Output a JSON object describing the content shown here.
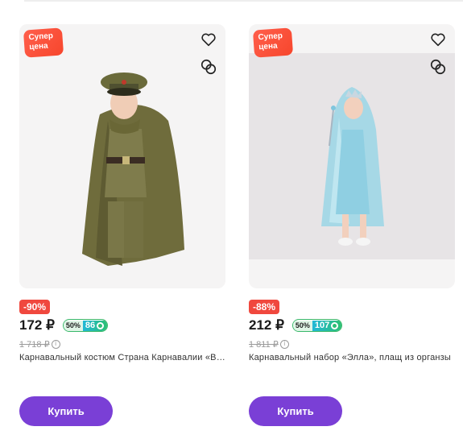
{
  "products": [
    {
      "badge": "Супер цена",
      "discount": "-90%",
      "price": "172 ₽",
      "cashback_pct": "50%",
      "cashback_bonus": "86",
      "old_price": "1 718 ₽",
      "title": "Карнавальный костюм Страна Карнавалии «Военный»",
      "buy_label": "Купить",
      "icons": {
        "favorite": "heart-icon",
        "compare": "compare-icon",
        "info": "info-icon"
      }
    },
    {
      "badge": "Супер цена",
      "discount": "-88%",
      "price": "212 ₽",
      "cashback_pct": "50%",
      "cashback_bonus": "107",
      "old_price": "1 811 ₽",
      "title": "Карнавальный набор «Элла», плащ из органзы",
      "buy_label": "Купить",
      "icons": {
        "favorite": "heart-icon",
        "compare": "compare-icon",
        "info": "info-icon"
      }
    }
  ],
  "colors": {
    "accent": "#7a3fd6",
    "discount": "#f0483e",
    "badge": "#f7462c",
    "cashback": "#2bbf73"
  }
}
